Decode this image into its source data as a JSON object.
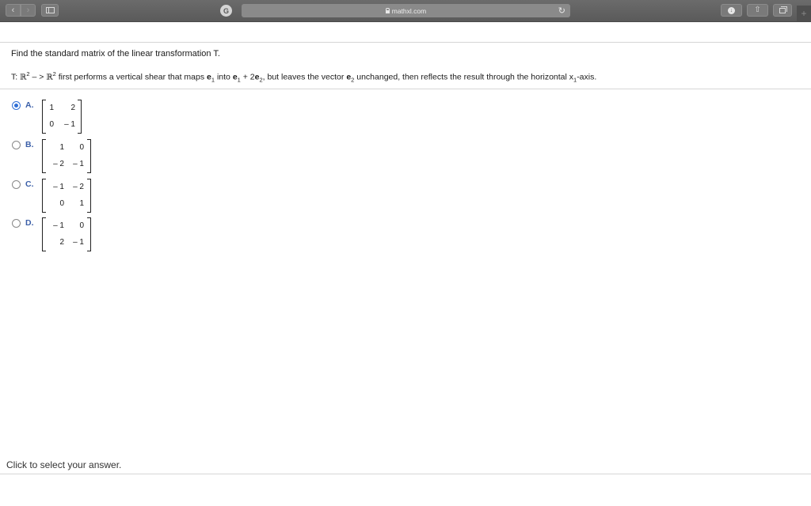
{
  "browser": {
    "url": "mathxl.com",
    "back_icon": "chevron-left-icon",
    "forward_icon": "chevron-right-icon"
  },
  "question": {
    "title": "Find the standard matrix of the linear transformation T.",
    "statement": {
      "t_prefix": "T: ",
      "domain": "ℝ",
      "domain_exp": "2",
      "arrow": " – > ",
      "codomain": "ℝ",
      "codomain_exp": "2",
      "part1": " first performs a vertical shear that maps ",
      "e1": "e",
      "e1_sub": "1",
      "into": " into ",
      "e1b": "e",
      "e1b_sub": "1",
      "plus": " + 2",
      "e2": "e",
      "e2_sub": "2",
      "part2": ", but leaves the vector ",
      "e2b": "e",
      "e2b_sub": "2",
      "part3": " unchanged, then reflects the result through the horizontal x",
      "x1_sub": "1",
      "part4": "-axis."
    }
  },
  "options": [
    {
      "letter": "A.",
      "selected": true,
      "matrix": [
        [
          "1",
          "2"
        ],
        [
          "0",
          "– 1"
        ]
      ]
    },
    {
      "letter": "B.",
      "selected": false,
      "matrix": [
        [
          "1",
          "0"
        ],
        [
          "– 2",
          "– 1"
        ]
      ]
    },
    {
      "letter": "C.",
      "selected": false,
      "matrix": [
        [
          "– 1",
          "– 2"
        ],
        [
          "0",
          "1"
        ]
      ]
    },
    {
      "letter": "D.",
      "selected": false,
      "matrix": [
        [
          "– 1",
          "0"
        ],
        [
          "2",
          "– 1"
        ]
      ]
    }
  ],
  "footer": {
    "instruction": "Click to select your answer."
  }
}
